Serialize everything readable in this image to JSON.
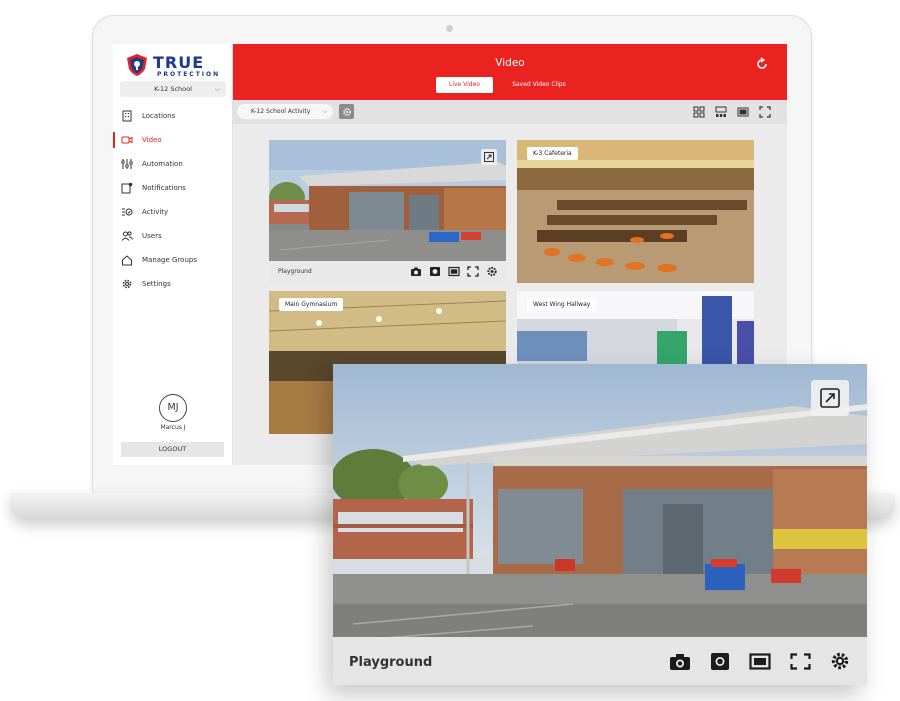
{
  "brand": {
    "word": "TRUE",
    "sub": "PROTECTION",
    "color": "#1e3a8a",
    "accent": "#ea2321"
  },
  "sidebar": {
    "school": "K-12 School",
    "items": [
      {
        "label": "Locations",
        "icon": "building-icon"
      },
      {
        "label": "Video",
        "icon": "video-camera-icon",
        "active": true
      },
      {
        "label": "Automation",
        "icon": "sliders-icon"
      },
      {
        "label": "Notifications",
        "icon": "bell-square-icon"
      },
      {
        "label": "Activity",
        "icon": "activity-list-icon"
      },
      {
        "label": "Users",
        "icon": "users-icon"
      },
      {
        "label": "Manage Groups",
        "icon": "home-icon"
      },
      {
        "label": "Settings",
        "icon": "gear-icon"
      }
    ],
    "user": {
      "initials": "MJ",
      "name": "Marcus J"
    },
    "logout": "LOGOUT"
  },
  "header": {
    "title": "Video",
    "tabs": [
      {
        "label": "Live Video",
        "active": true
      },
      {
        "label": "Saved Video Clips"
      }
    ]
  },
  "toolbar": {
    "activity_select": "K-12 School Activity"
  },
  "cameras": [
    {
      "label": "Playground"
    },
    {
      "label": "K-3 Cafeteria"
    },
    {
      "label": "Main Gymnasium"
    },
    {
      "label": "West Wing Hallway"
    }
  ],
  "popout": {
    "label": "Playground"
  }
}
